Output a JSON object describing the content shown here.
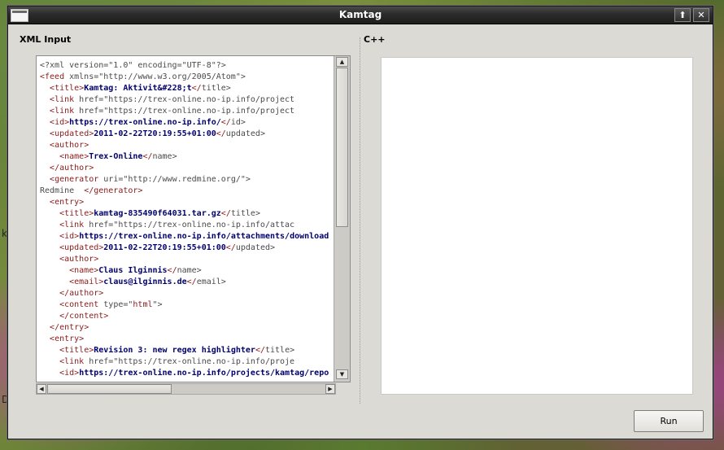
{
  "window": {
    "title": "Kamtag"
  },
  "titlebar": {
    "maximize_glyph": "⬆",
    "close_glyph": "✕"
  },
  "left_panel": {
    "label": "XML Input"
  },
  "right_panel": {
    "label": "C++",
    "output_text": ""
  },
  "editor": {
    "lines": [
      [
        [
          "plain",
          "<?xml version=\"1.0\" encoding=\"UTF-8\"?>"
        ]
      ],
      [
        [
          "tag",
          "<feed "
        ],
        [
          "plain",
          "xmlns=\"http://www.w3.org/2005/Atom\">"
        ]
      ],
      [
        [
          "plain",
          "  "
        ],
        [
          "tag",
          "<title>"
        ],
        [
          "bold",
          "Kamtag: Aktivit&#228;t"
        ],
        [
          "tag",
          "</"
        ],
        [
          "plain",
          "title>"
        ]
      ],
      [
        [
          "plain",
          "  "
        ],
        [
          "tag",
          "<link "
        ],
        [
          "plain",
          "href=\"https://trex-online.no-ip.info/project"
        ]
      ],
      [
        [
          "plain",
          "  "
        ],
        [
          "tag",
          "<link "
        ],
        [
          "plain",
          "href=\"https://trex-online.no-ip.info/project"
        ]
      ],
      [
        [
          "plain",
          "  "
        ],
        [
          "tag",
          "<id>"
        ],
        [
          "bold",
          "https://trex-online.no-ip.info/"
        ],
        [
          "tag",
          "</"
        ],
        [
          "plain",
          "id>"
        ]
      ],
      [
        [
          "plain",
          "  "
        ],
        [
          "tag",
          "<updated>"
        ],
        [
          "bold",
          "2011-02-22T20:19:55+01:00"
        ],
        [
          "tag",
          "</"
        ],
        [
          "plain",
          "updated>"
        ]
      ],
      [
        [
          "plain",
          "  "
        ],
        [
          "tag",
          "<author>"
        ]
      ],
      [
        [
          "plain",
          "    "
        ],
        [
          "tag",
          "<name>"
        ],
        [
          "bold",
          "Trex-Online"
        ],
        [
          "tag",
          "</"
        ],
        [
          "plain",
          "name>"
        ]
      ],
      [
        [
          "plain",
          "  "
        ],
        [
          "tag",
          "</author>"
        ]
      ],
      [
        [
          "plain",
          "  "
        ],
        [
          "tag",
          "<generator "
        ],
        [
          "plain",
          "uri=\"http://www.redmine.org/\">"
        ]
      ],
      [
        [
          "plain",
          "Redmine  "
        ],
        [
          "tag",
          "</generator>"
        ]
      ],
      [
        [
          "plain",
          "  "
        ],
        [
          "tag",
          "<entry>"
        ]
      ],
      [
        [
          "plain",
          "    "
        ],
        [
          "tag",
          "<title>"
        ],
        [
          "bold",
          "kamtag-835490f64031.tar.gz"
        ],
        [
          "tag",
          "</"
        ],
        [
          "plain",
          "title>"
        ]
      ],
      [
        [
          "plain",
          "    "
        ],
        [
          "tag",
          "<link "
        ],
        [
          "plain",
          "href=\"https://trex-online.no-ip.info/attac"
        ]
      ],
      [
        [
          "plain",
          "    "
        ],
        [
          "tag",
          "<id>"
        ],
        [
          "bold",
          "https://trex-online.no-ip.info/attachments/download"
        ]
      ],
      [
        [
          "plain",
          "    "
        ],
        [
          "tag",
          "<updated>"
        ],
        [
          "bold",
          "2011-02-22T20:19:55+01:00"
        ],
        [
          "tag",
          "</"
        ],
        [
          "plain",
          "updated>"
        ]
      ],
      [
        [
          "plain",
          "    "
        ],
        [
          "tag",
          "<author>"
        ]
      ],
      [
        [
          "plain",
          "      "
        ],
        [
          "tag",
          "<name>"
        ],
        [
          "bold",
          "Claus Ilginnis"
        ],
        [
          "tag",
          "</"
        ],
        [
          "plain",
          "name>"
        ]
      ],
      [
        [
          "plain",
          "      "
        ],
        [
          "tag",
          "<email>"
        ],
        [
          "bold",
          "claus@ilginnis.de"
        ],
        [
          "tag",
          "</"
        ],
        [
          "plain",
          "email>"
        ]
      ],
      [
        [
          "plain",
          "    "
        ],
        [
          "tag",
          "</author>"
        ]
      ],
      [
        [
          "plain",
          "    "
        ],
        [
          "tag",
          "<content "
        ],
        [
          "plain",
          "type=\""
        ],
        [
          "attrv",
          "html"
        ],
        [
          "plain",
          "\">"
        ]
      ],
      [
        [
          "plain",
          "    "
        ],
        [
          "tag",
          "</content>"
        ]
      ],
      [
        [
          "plain",
          "  "
        ],
        [
          "tag",
          "</entry>"
        ]
      ],
      [
        [
          "plain",
          "  "
        ],
        [
          "tag",
          "<entry>"
        ]
      ],
      [
        [
          "plain",
          "    "
        ],
        [
          "tag",
          "<title>"
        ],
        [
          "bold",
          "Revision 3: new regex highlighter"
        ],
        [
          "tag",
          "</"
        ],
        [
          "plain",
          "title>"
        ]
      ],
      [
        [
          "plain",
          "    "
        ],
        [
          "tag",
          "<link "
        ],
        [
          "plain",
          "href=\"https://trex-online.no-ip.info/proje"
        ]
      ],
      [
        [
          "plain",
          "    "
        ],
        [
          "tag",
          "<id>"
        ],
        [
          "bold",
          "https://trex-online.no-ip.info/projects/kamtag/repo"
        ]
      ]
    ]
  },
  "run_button": {
    "label": "Run"
  },
  "desktop": {
    "left_glyph_1": "k",
    "left_glyph_2": "D"
  }
}
